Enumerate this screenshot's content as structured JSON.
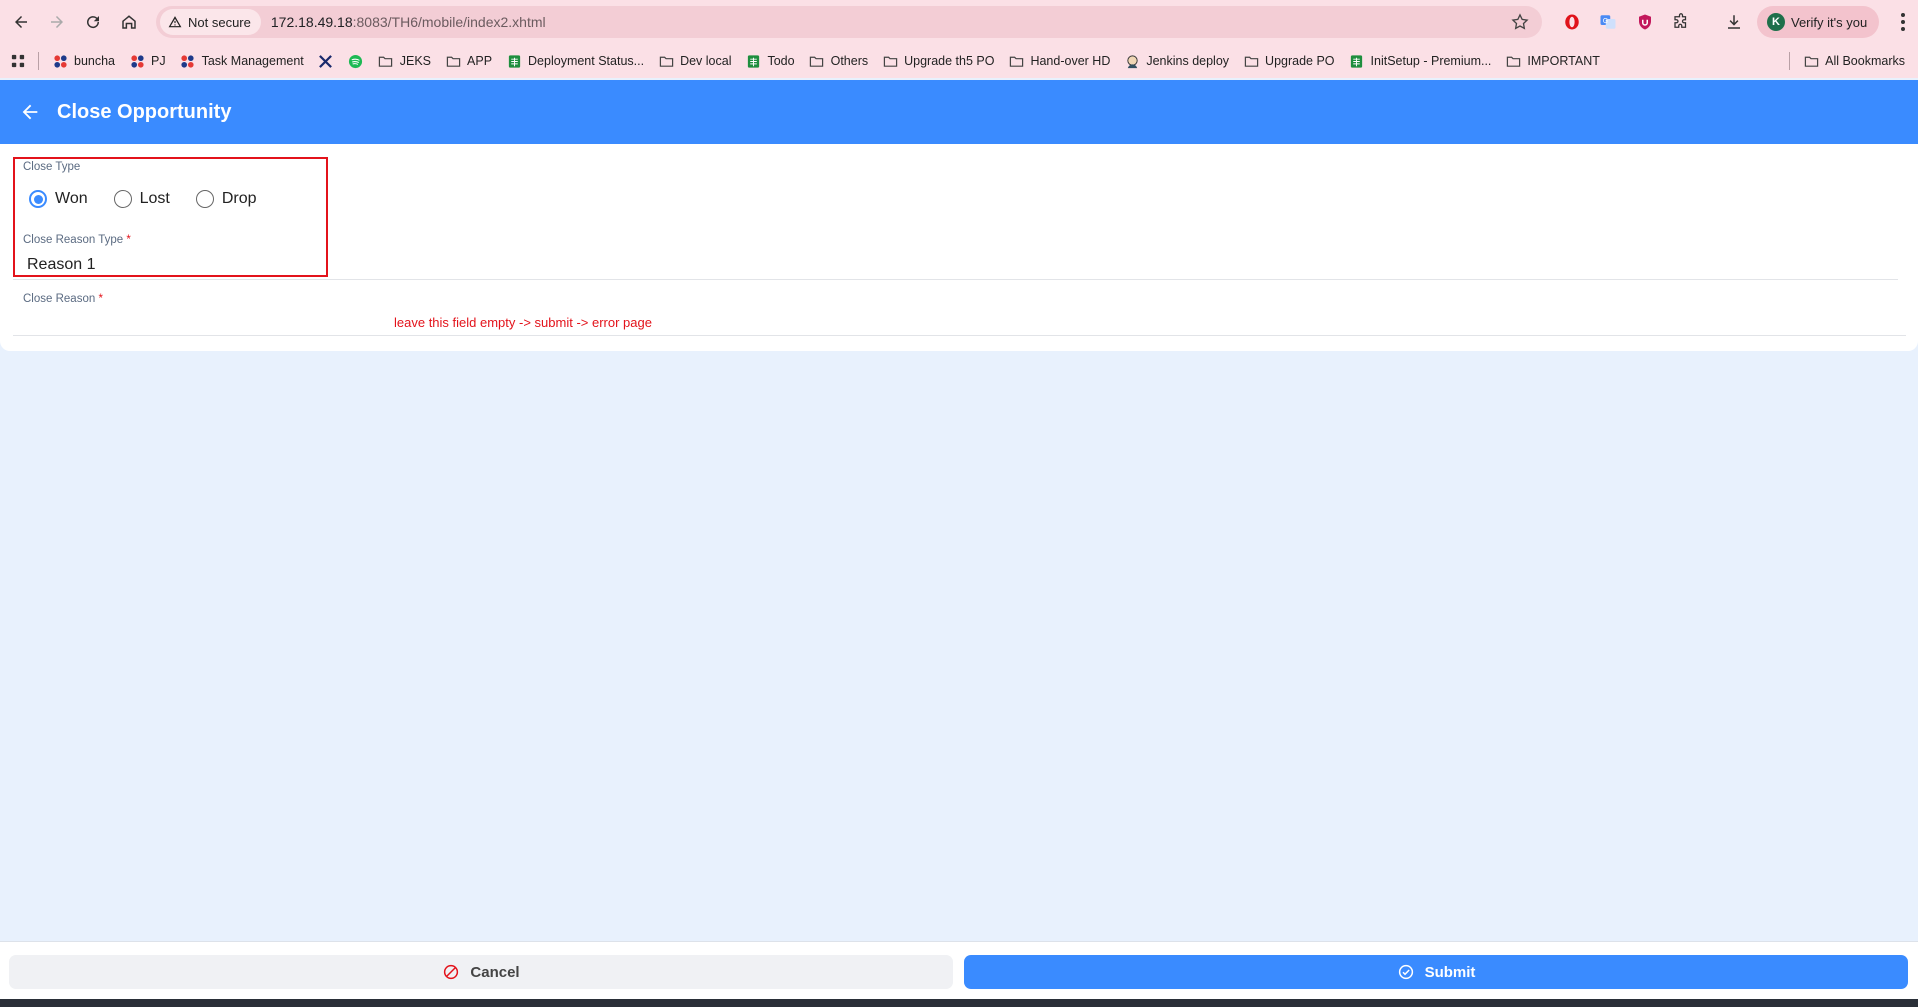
{
  "browser": {
    "security_label": "Not secure",
    "url_host": "172.18.49.18",
    "url_rest": ":8083/TH6/mobile/index2.xhtml",
    "profile_label": "Verify it's you",
    "profile_initial": "K"
  },
  "bookmarks": {
    "items": [
      {
        "label": "buncha",
        "icon": "colored-dots-icon"
      },
      {
        "label": "PJ",
        "icon": "colored-dots-icon"
      },
      {
        "label": "Task Management",
        "icon": "colored-dots-icon"
      },
      {
        "label": "",
        "icon": "tool-icon"
      },
      {
        "label": "",
        "icon": "spotify-icon"
      },
      {
        "label": "JEKS",
        "icon": "folder-icon"
      },
      {
        "label": "APP",
        "icon": "folder-icon"
      },
      {
        "label": "Deployment Status...",
        "icon": "sheet-icon"
      },
      {
        "label": "Dev local",
        "icon": "folder-icon"
      },
      {
        "label": "Todo",
        "icon": "sheet-icon"
      },
      {
        "label": "Others",
        "icon": "folder-icon"
      },
      {
        "label": "Upgrade th5 PO",
        "icon": "folder-icon"
      },
      {
        "label": "Hand-over HD",
        "icon": "folder-icon"
      },
      {
        "label": "Jenkins deploy",
        "icon": "jenkins-icon"
      },
      {
        "label": "Upgrade PO",
        "icon": "folder-icon"
      },
      {
        "label": "InitSetup - Premium...",
        "icon": "sheet-icon"
      },
      {
        "label": "IMPORTANT",
        "icon": "folder-icon"
      }
    ],
    "all_bookmarks": "All Bookmarks"
  },
  "header": {
    "title": "Close Opportunity"
  },
  "form": {
    "close_type_label": "Close Type",
    "close_type_options": [
      "Won",
      "Lost",
      "Drop"
    ],
    "close_type_selected": "Won",
    "close_reason_type_label": "Close Reason Type",
    "close_reason_type_value": "Reason 1",
    "close_reason_label": "Close Reason",
    "required_mark": "*",
    "close_reason_value": "",
    "annotation": "leave this field empty -> submit -> error page"
  },
  "footer": {
    "cancel_label": "Cancel",
    "submit_label": "Submit"
  },
  "colors": {
    "primary": "#3a8bff",
    "annotation_red": "#e3131b",
    "chrome": "#fbe0e6",
    "page_bg": "#e8f1fd"
  }
}
